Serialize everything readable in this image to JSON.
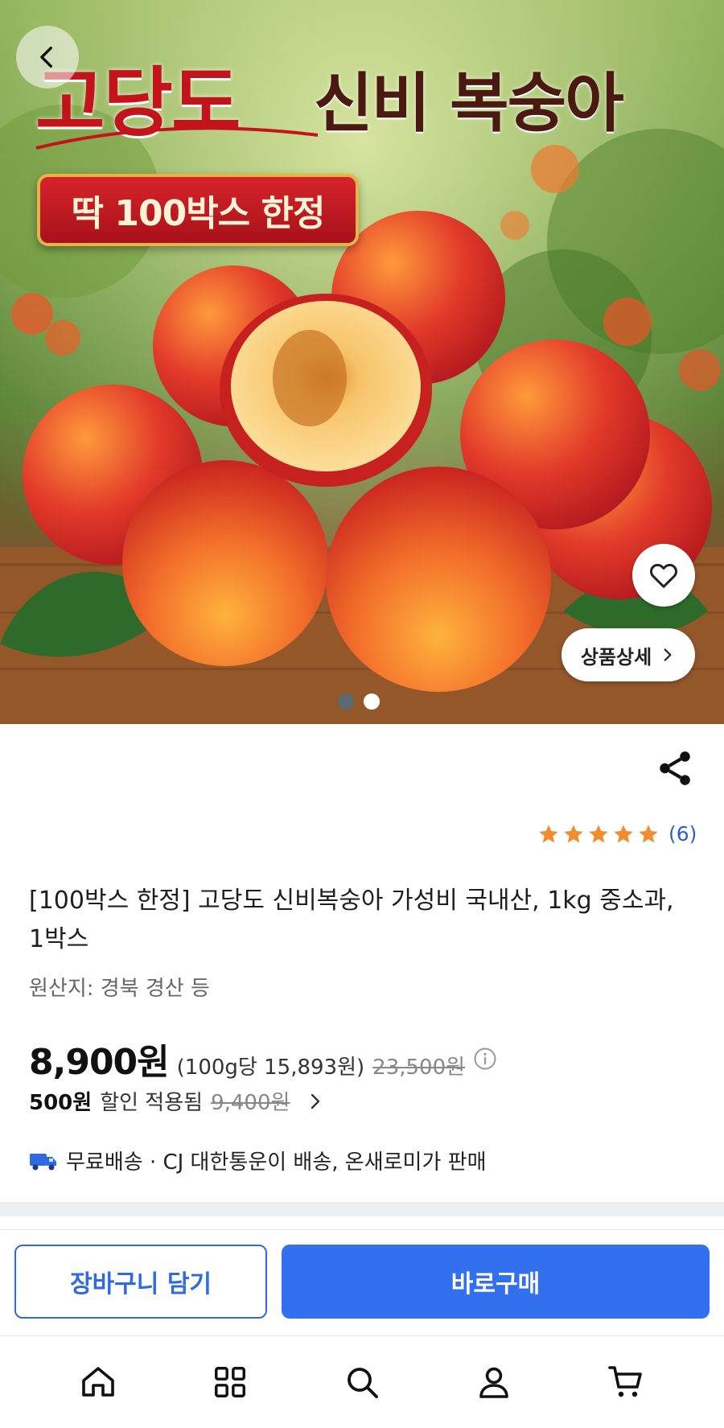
{
  "hero": {
    "title_main": "고당도",
    "title_sub": "신비 복숭아",
    "badge": "딱 100박스 한정",
    "detail_label": "상품상세",
    "slides": {
      "current": 1,
      "total": 2
    }
  },
  "product": {
    "rating": 5,
    "review_count": "(6)",
    "title": "[100박스 한정] 고당도 신비복숭아 가성비 국내산, 1kg 중소과, 1박스",
    "origin": "원산지: 경북 경산 등",
    "price": "8,900원",
    "unit_price": "(100g당 15,893원)",
    "original_price": "23,500원",
    "discount_amount": "500원",
    "discount_label": "할인 적용됨",
    "discount_original": "9,400원",
    "shipping": "무료배송 · CJ 대한통운이 배송, 온새로미가 판매"
  },
  "actions": {
    "cart_label": "장바구니 담기",
    "buy_label": "바로구매"
  },
  "nav": [
    "home-icon",
    "category-grid-icon",
    "search-icon",
    "profile-icon",
    "cart-icon"
  ],
  "colors": {
    "accent_blue": "#3370f0",
    "star": "#f28c2c",
    "title_red": "#c4141b"
  }
}
